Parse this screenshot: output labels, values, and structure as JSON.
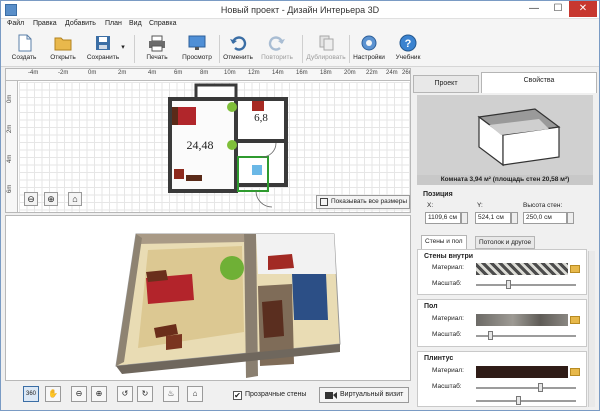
{
  "window": {
    "title": "Новый проект - Дизайн Интерьера 3D",
    "minimize": "—",
    "maximize": "☐",
    "close": "✕"
  },
  "menu": [
    "Файл",
    "Правка",
    "Добавить",
    "План",
    "Вид",
    "Справка"
  ],
  "toolbar": {
    "create": "Создать",
    "open": "Открыть",
    "save": "Сохранить",
    "print": "Печать",
    "preview": "Просмотр",
    "undo": "Отменить",
    "redo": "Повторить",
    "duplicate": "Дублировать",
    "settings": "Настройки",
    "tutorial": "Учебник"
  },
  "plan": {
    "ruler_h": [
      "-4m",
      "-2m",
      "0m",
      "2m",
      "4m",
      "6m",
      "8m",
      "10m",
      "12m",
      "14m",
      "16m",
      "18m",
      "20m",
      "22m",
      "24m",
      "26m"
    ],
    "ruler_v": [
      "0m",
      "2m",
      "4m",
      "6m"
    ],
    "room_big_area": "24,48",
    "room_small_area": "6,8",
    "show_all_label": "Показывать все размеры"
  },
  "view3d": {
    "transparent_walls_label": "Прозрачные стены",
    "transparent_walls_checked": "✔",
    "virtual_visit_label": "Виртуальный визит"
  },
  "panel": {
    "tab_project": "Проект",
    "tab_properties": "Свойства",
    "room_caption": "Комната 3,94 м²  (площадь стен 20,58 м²)",
    "position_label": "Позиция",
    "x_label": "X:",
    "y_label": "Y:",
    "height_label": "Высота стен:",
    "x_value": "1109,6 см",
    "y_value": "524,1 см",
    "height_value": "250,0 см",
    "subtab_walls": "Стены и пол",
    "subtab_ceiling": "Потолок и другое",
    "walls_inside": "Стены внутри",
    "floor": "Пол",
    "plinth": "Плинтус",
    "material_label": "Материал:",
    "scale_label": "Масштаб:"
  },
  "colors": {
    "accent": "#3b6ea5",
    "wall": "#3a3a3a",
    "selection": "#2f9b2f",
    "close_button": "#c7372f"
  }
}
